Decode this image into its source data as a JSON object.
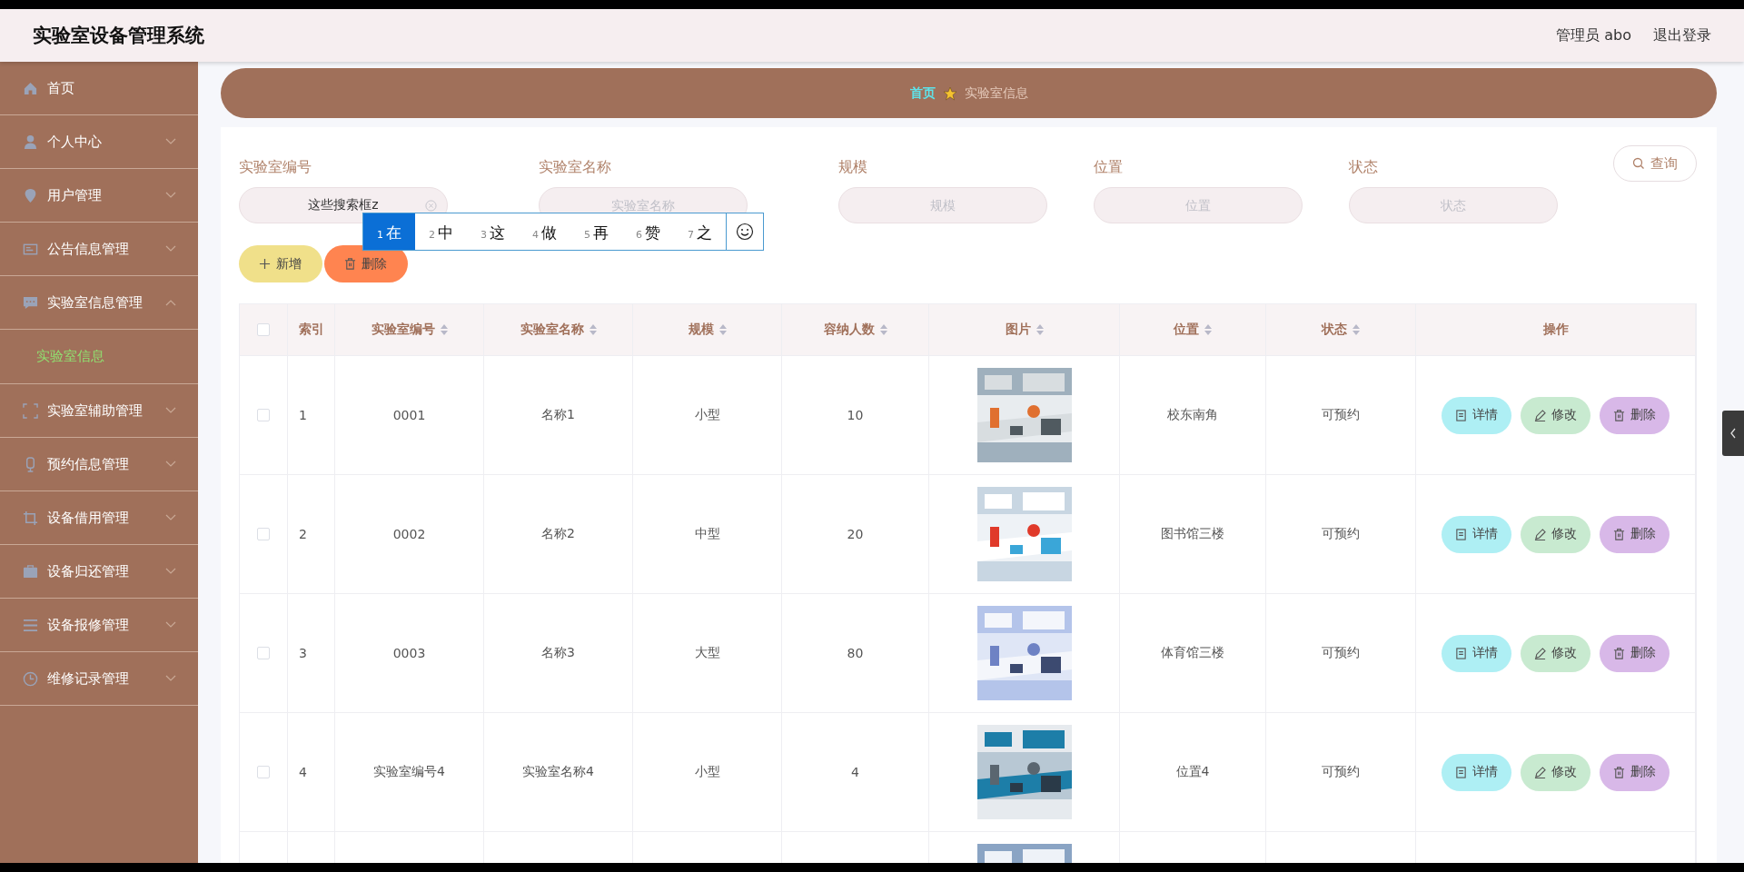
{
  "header": {
    "title": "实验室设备管理系统",
    "user": "管理员 abo",
    "logout": "退出登录"
  },
  "sidebar": {
    "items": [
      {
        "label": "首页"
      },
      {
        "label": "个人中心",
        "expanded": false
      },
      {
        "label": "用户管理",
        "expanded": false
      },
      {
        "label": "公告信息管理",
        "expanded": false
      },
      {
        "label": "实验室信息管理",
        "expanded": true,
        "children": [
          {
            "label": "实验室信息",
            "selected": true
          }
        ]
      },
      {
        "label": "实验室辅助管理",
        "expanded": false
      },
      {
        "label": "预约信息管理",
        "expanded": false
      },
      {
        "label": "设备借用管理",
        "expanded": false
      },
      {
        "label": "设备归还管理",
        "expanded": false
      },
      {
        "label": "设备报修管理",
        "expanded": false
      },
      {
        "label": "维修记录管理",
        "expanded": false
      }
    ]
  },
  "breadcrumb": {
    "home": "首页",
    "current": "实验室信息"
  },
  "search": {
    "fields": [
      {
        "label": "实验室编号",
        "value": "这些搜索框z"
      },
      {
        "label": "实验室名称",
        "placeholder": "实验室名称"
      },
      {
        "label": "规模",
        "placeholder": "规模"
      },
      {
        "label": "位置",
        "placeholder": "位置"
      },
      {
        "label": "状态",
        "placeholder": "状态"
      }
    ],
    "button": "查询"
  },
  "ime": {
    "candidates": [
      {
        "index": "1",
        "text": "在",
        "selected": true
      },
      {
        "index": "2",
        "text": "中",
        "selected": false
      },
      {
        "index": "3",
        "text": "这",
        "selected": false
      },
      {
        "index": "4",
        "text": "做",
        "selected": false
      },
      {
        "index": "5",
        "text": "再",
        "selected": false
      },
      {
        "index": "6",
        "text": "赞",
        "selected": false
      },
      {
        "index": "7",
        "text": "之",
        "selected": false
      }
    ]
  },
  "actions": [
    {
      "label": "新增",
      "kind": "add"
    },
    {
      "label": "删除",
      "kind": "delete"
    }
  ],
  "table": {
    "select_all_checked": false,
    "columns": [
      {
        "label": "索引",
        "sortable": false
      },
      {
        "label": "实验室编号",
        "sortable": true
      },
      {
        "label": "实验室名称",
        "sortable": true
      },
      {
        "label": "规模",
        "sortable": true
      },
      {
        "label": "容纳人数",
        "sortable": true
      },
      {
        "label": "图片",
        "sortable": true
      },
      {
        "label": "位置",
        "sortable": true
      },
      {
        "label": "状态",
        "sortable": true
      },
      {
        "label": "操作",
        "sortable": false
      }
    ],
    "rows": [
      {
        "checked": false,
        "cells": [
          "1",
          "0001",
          "名称1",
          "小型",
          "10"
        ],
        "image": {
          "kind": "picture"
        },
        "cells_after": [
          "校东南角",
          "可预约"
        ],
        "buttons": [
          {
            "label": "详情",
            "kind": "detail"
          },
          {
            "label": "修改",
            "kind": "edit"
          },
          {
            "label": "删除",
            "kind": "delete"
          }
        ]
      },
      {
        "checked": false,
        "cells": [
          "2",
          "0002",
          "名称2",
          "中型",
          "20"
        ],
        "image": {
          "kind": "picture"
        },
        "cells_after": [
          "图书馆三楼",
          "可预约"
        ],
        "buttons": [
          {
            "label": "详情",
            "kind": "detail"
          },
          {
            "label": "修改",
            "kind": "edit"
          },
          {
            "label": "删除",
            "kind": "delete"
          }
        ]
      },
      {
        "checked": false,
        "cells": [
          "3",
          "0003",
          "名称3",
          "大型",
          "80"
        ],
        "image": {
          "kind": "picture"
        },
        "cells_after": [
          "体育馆三楼",
          "可预约"
        ],
        "buttons": [
          {
            "label": "详情",
            "kind": "detail"
          },
          {
            "label": "修改",
            "kind": "edit"
          },
          {
            "label": "删除",
            "kind": "delete"
          }
        ]
      },
      {
        "checked": false,
        "cells": [
          "4",
          "实验室编号4",
          "实验室名称4",
          "小型",
          "4"
        ],
        "image": {
          "kind": "picture"
        },
        "cells_after": [
          "位置4",
          "可预约"
        ],
        "buttons": [
          {
            "label": "详情",
            "kind": "detail"
          },
          {
            "label": "修改",
            "kind": "edit"
          },
          {
            "label": "删除",
            "kind": "delete"
          }
        ]
      },
      {
        "image": {
          "kind": "picture"
        }
      }
    ]
  }
}
